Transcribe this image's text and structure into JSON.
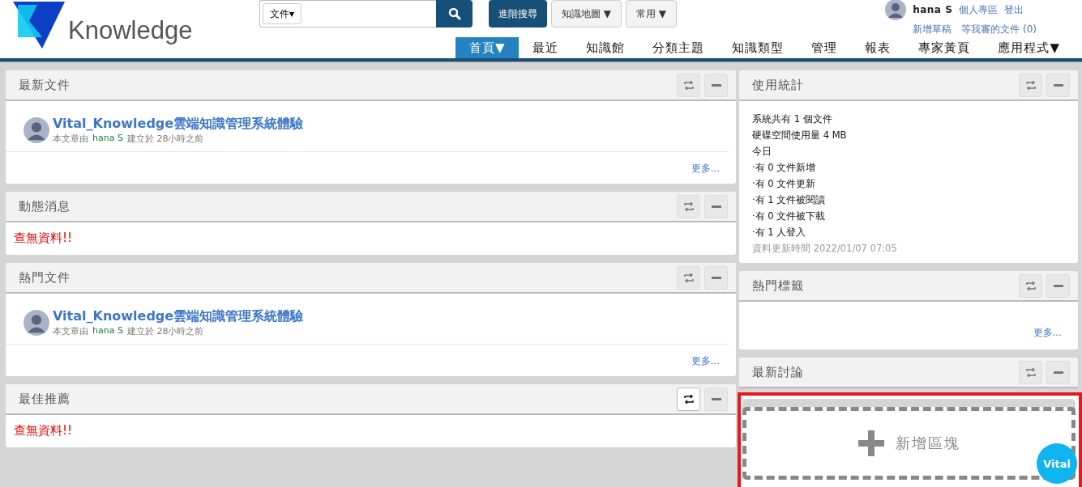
{
  "logo": {
    "text": "Knowledge"
  },
  "search": {
    "scope": "文件▾"
  },
  "header_buttons": [
    {
      "label": "進階搜尋",
      "kind": "primary"
    },
    {
      "label": "知識地圖 ▼",
      "kind": "plain"
    },
    {
      "label": "常用 ▼",
      "kind": "plain"
    }
  ],
  "user": {
    "name": "hana S",
    "links": [
      "個人專區",
      "登出"
    ],
    "sub_links": [
      "新增草稿",
      "等我審的文件 (0)"
    ]
  },
  "nav": [
    {
      "label": "首頁▼",
      "selected": true
    },
    {
      "label": "最近",
      "selected": false
    },
    {
      "label": "知識館",
      "selected": false
    },
    {
      "label": "分類主題",
      "selected": false
    },
    {
      "label": "知識類型",
      "selected": false
    },
    {
      "label": "管理",
      "selected": false
    },
    {
      "label": "報表",
      "selected": false
    },
    {
      "label": "專家黃頁",
      "selected": false
    },
    {
      "label": "應用程式▼",
      "selected": false
    }
  ],
  "left_panels": [
    {
      "title": "最新文件",
      "kind": "docs",
      "refresh_highlighted": false,
      "docs": [
        {
          "title": "Vital_Knowledge雲端知識管理系統體驗",
          "prefix": "本文章由",
          "author": "hana S",
          "suffix": "建立於 28小時之前"
        }
      ],
      "more": "更多..."
    },
    {
      "title": "動態消息",
      "kind": "empty",
      "refresh_highlighted": false,
      "message": "查無資料!!"
    },
    {
      "title": "熱門文件",
      "kind": "docs",
      "refresh_highlighted": false,
      "docs": [
        {
          "title": "Vital_Knowledge雲端知識管理系統體驗",
          "prefix": "本文章由",
          "author": "hana S",
          "suffix": "建立於 28小時之前"
        }
      ],
      "more": "更多..."
    },
    {
      "title": "最佳推薦",
      "kind": "empty",
      "refresh_highlighted": true,
      "message": "查無資料!!"
    }
  ],
  "right_panels": [
    {
      "title": "使用統計",
      "kind": "stats",
      "refresh_highlighted": false,
      "lines": [
        "系統共有 1 個文件",
        "硬碟空間使用量 4 MB",
        "今日",
        "·有 0 文件新增",
        "·有 0 文件更新",
        "·有 1 文件被閱讀",
        "·有 0 文件被下載",
        "·有 1 人登入"
      ],
      "updated": "資料更新時間 2022/01/07 07:05"
    },
    {
      "title": "熱門標籤",
      "kind": "tags",
      "refresh_highlighted": false,
      "more": "更多..."
    },
    {
      "title": "最新討論",
      "kind": "header",
      "refresh_highlighted": false
    }
  ],
  "add_block": {
    "label": "新增區塊"
  },
  "chat_badge": {
    "text": "Vital"
  }
}
